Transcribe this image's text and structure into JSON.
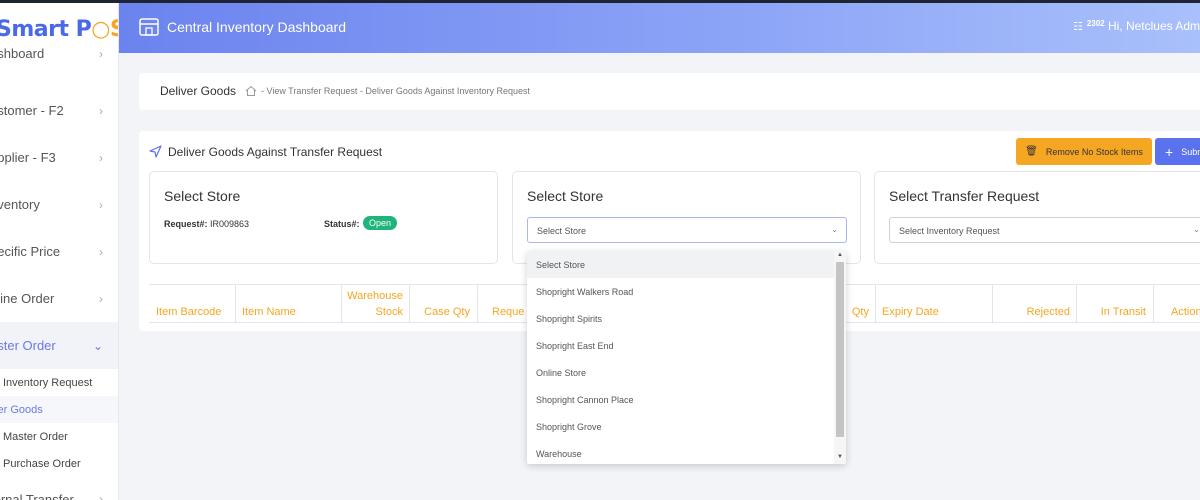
{
  "app": {
    "logo_text": "Smart POS"
  },
  "header": {
    "title": "Central Inventory Dashboard",
    "notif_count": "2302",
    "greeting": "Hi,  Netclues Adm"
  },
  "sidebar": {
    "items": [
      {
        "label": "ashboard"
      },
      {
        "label": "ustomer - F2"
      },
      {
        "label": "upplier - F3"
      },
      {
        "label": "nventory"
      },
      {
        "label": "pecific Price"
      },
      {
        "label": "nline Order"
      },
      {
        "label": "aster Order"
      },
      {
        "label": "ternal Transfer"
      }
    ],
    "subitems": [
      {
        "label": "w Inventory Request"
      },
      {
        "label": "ver Goods"
      },
      {
        "label": "w Master Order"
      },
      {
        "label": "w Purchase Order"
      }
    ]
  },
  "breadcrumb": {
    "title": "Deliver Goods",
    "path": "- View Transfer Request - Deliver Goods Against Inventory Request"
  },
  "main": {
    "title": "Deliver Goods Against Transfer Request",
    "remove_btn": "Remove No Stock Items",
    "submit_btn": "Subm"
  },
  "store_card": {
    "title": "Select Store",
    "request_label": "Request#:",
    "request_value": "IR009863",
    "status_label": "Status#:",
    "status_value": "Open"
  },
  "store_select": {
    "title": "Select Store",
    "value": "Select Store"
  },
  "transfer_select": {
    "title": "Select Transfer Request",
    "value": "Select Inventory Request"
  },
  "table": {
    "headers": [
      "Item Barcode",
      "Item Name",
      "Warehouse",
      "Stock",
      "Case Qty",
      "Reque",
      "Qty",
      "Expiry Date",
      "Rejected",
      "In Transit",
      "Action"
    ]
  },
  "dropdown": {
    "options": [
      "Select Store",
      "Shopright Walkers Road",
      "Shopright Spirits",
      "Shopright East End",
      "Online Store",
      "Shopright Cannon Place",
      "Shopright Grove",
      "Warehouse"
    ]
  },
  "colors": {
    "accent": "#6b83ee",
    "warning": "#f5a623",
    "success": "#1fb57a",
    "primary_btn": "#5b72ee"
  }
}
